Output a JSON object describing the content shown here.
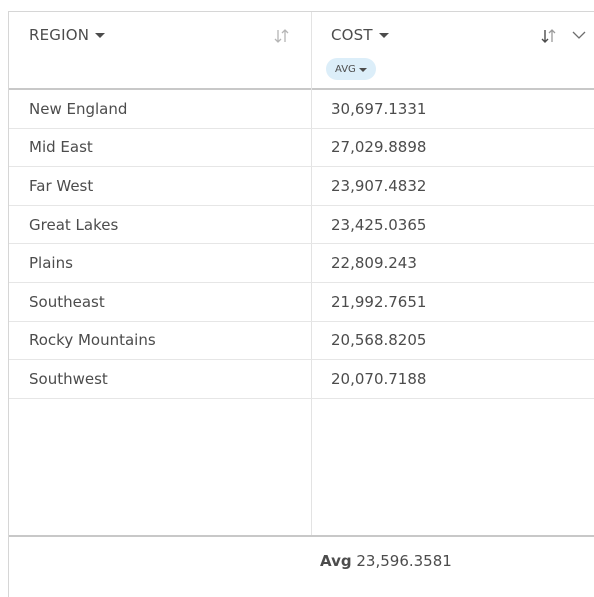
{
  "header": {
    "columns": [
      {
        "label": "REGION"
      },
      {
        "label": "COST",
        "aggregation": "AVG"
      }
    ]
  },
  "rows": [
    {
      "region": "New England",
      "cost": "30,697.1331"
    },
    {
      "region": "Mid East",
      "cost": "27,029.8898"
    },
    {
      "region": "Far West",
      "cost": "23,907.4832"
    },
    {
      "region": "Great Lakes",
      "cost": "23,425.0365"
    },
    {
      "region": "Plains",
      "cost": "22,809.243"
    },
    {
      "region": "Southeast",
      "cost": "21,992.7651"
    },
    {
      "region": "Rocky Mountains",
      "cost": "20,568.8205"
    },
    {
      "region": "Southwest",
      "cost": "20,070.7188"
    }
  ],
  "footer": {
    "summary_label": "Avg",
    "summary_value": "23,596.3581"
  }
}
